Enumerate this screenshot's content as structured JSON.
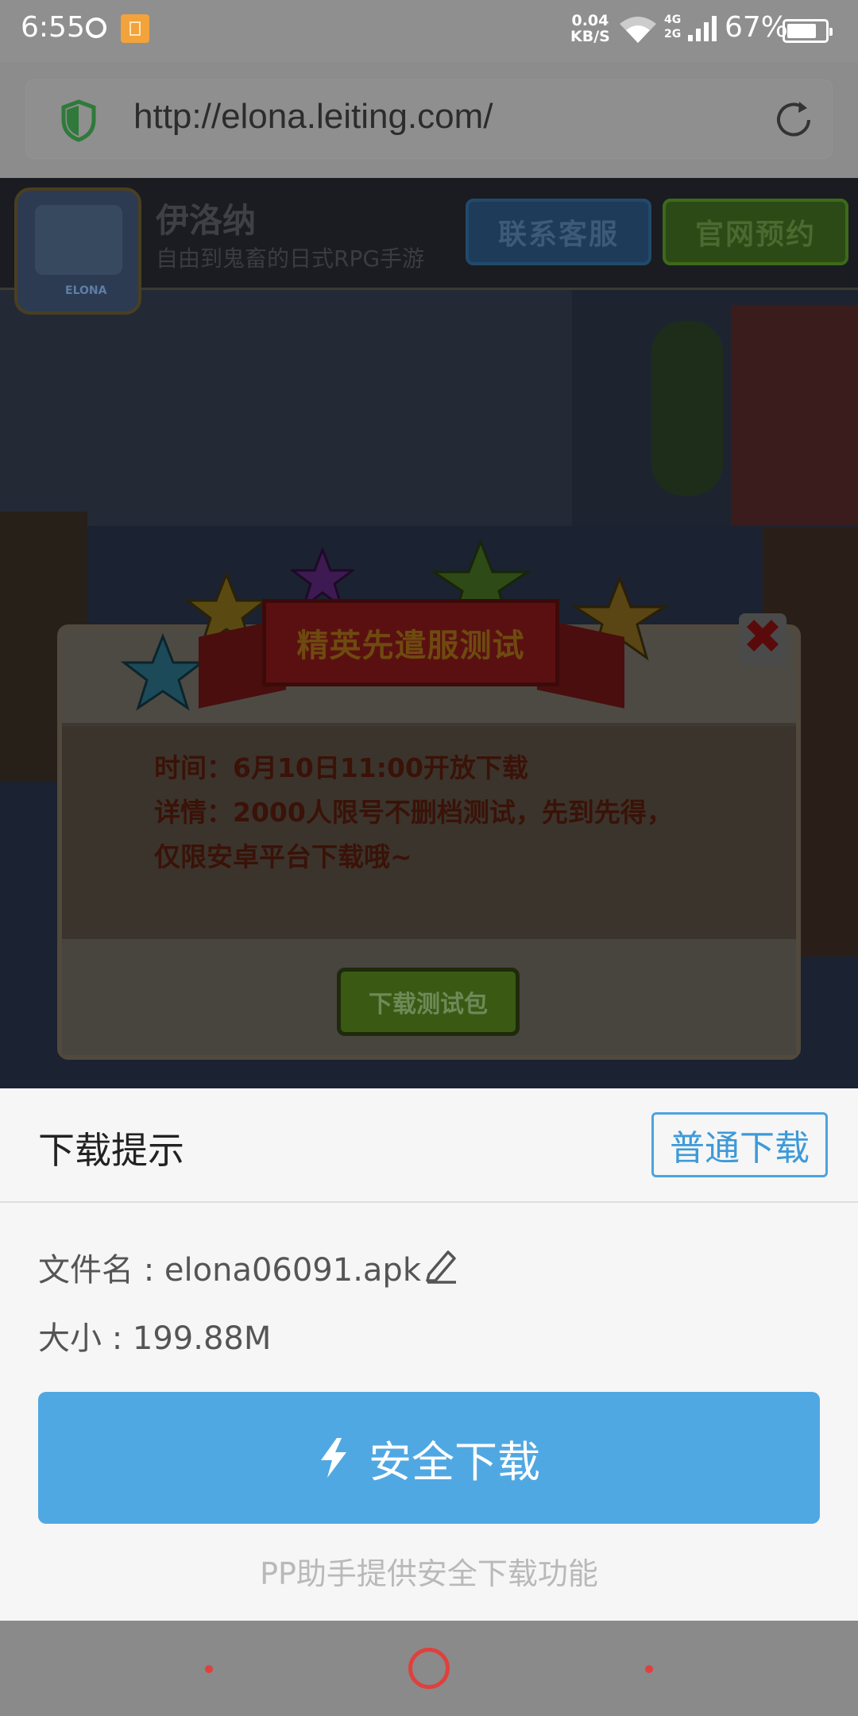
{
  "status_bar": {
    "time": "6:55",
    "speed_value": "0.04",
    "speed_unit": "KB/S",
    "net_4g": "4G",
    "net_2g": "2G",
    "battery": "67%"
  },
  "browser": {
    "url": "http://elona.leiting.com/"
  },
  "page": {
    "game_title": "伊洛纳",
    "game_subtitle": "自由到鬼畜的日式RPG手游",
    "contact_button": "联系客服",
    "reserve_button": "官网预约",
    "modal": {
      "ribbon_title": "精英先遣服测试",
      "line1": "时间：6月10日11:00开放下载",
      "line2": "详情：2000人限号不删档测试，先到先得，",
      "line3": "仅限安卓平台下载哦~",
      "download_button": "下载测试包"
    }
  },
  "download_sheet": {
    "title": "下载提示",
    "normal_download": "普通下载",
    "file_name": "文件名 : elona06091.apk",
    "size": "大小 : 199.88M",
    "safe_download": "安全下载",
    "note": "PP助手提供安全下载功能"
  },
  "colors": {
    "accent_blue": "#50a8e3",
    "nav_red": "#e0403d"
  }
}
